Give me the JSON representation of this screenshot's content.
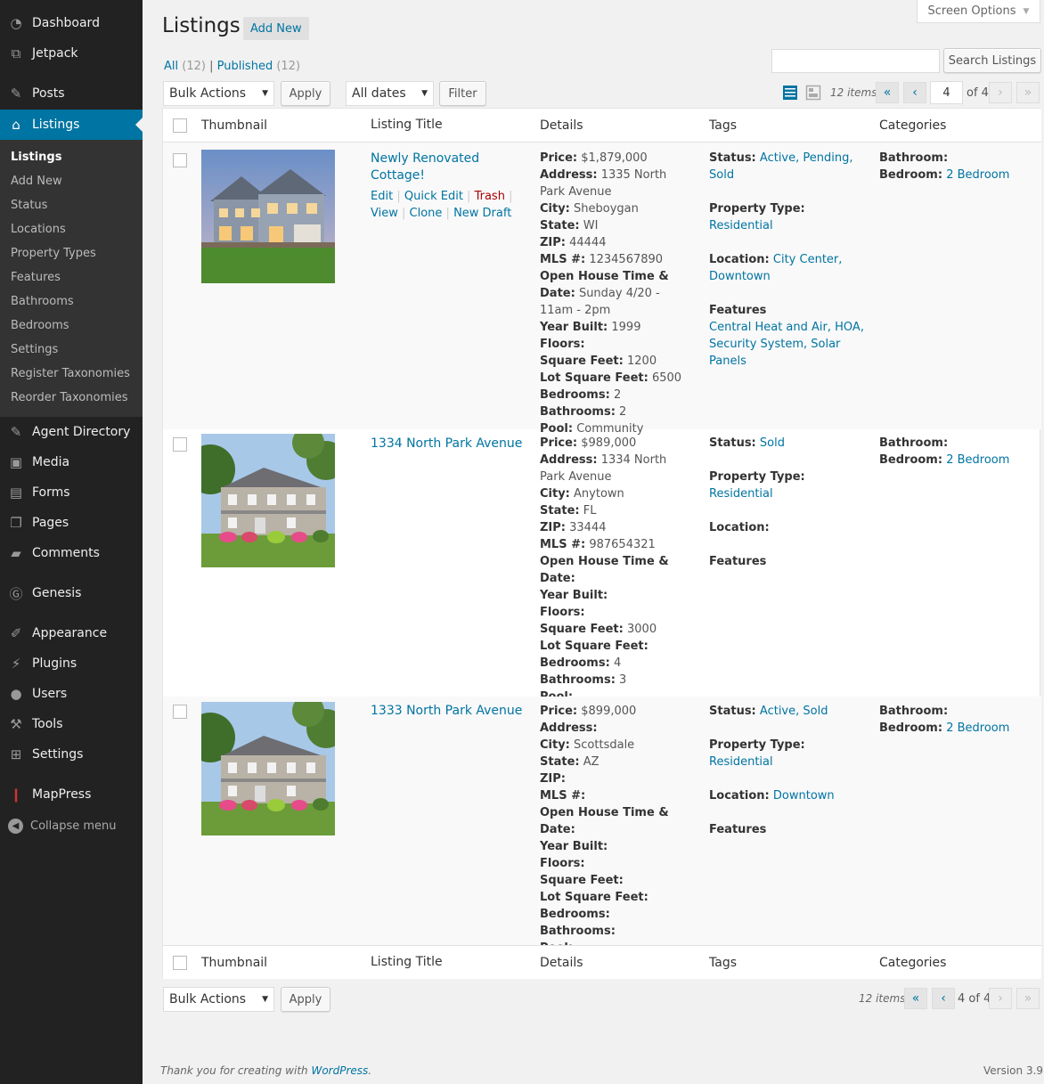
{
  "sidebar": {
    "menu": [
      {
        "label": "Dashboard",
        "icon": "dashboard-icon"
      },
      {
        "label": "Jetpack",
        "icon": "jetpack-icon"
      },
      {
        "label": "Posts",
        "icon": "pin-icon"
      },
      {
        "label": "Listings",
        "icon": "home-icon"
      },
      {
        "label": "Agent Directory",
        "icon": "pin-icon"
      },
      {
        "label": "Media",
        "icon": "media-icon"
      },
      {
        "label": "Forms",
        "icon": "forms-icon"
      },
      {
        "label": "Pages",
        "icon": "pages-icon"
      },
      {
        "label": "Comments",
        "icon": "comment-icon"
      },
      {
        "label": "Genesis",
        "icon": "genesis-icon"
      },
      {
        "label": "Appearance",
        "icon": "brush-icon"
      },
      {
        "label": "Plugins",
        "icon": "plug-icon"
      },
      {
        "label": "Users",
        "icon": "user-icon"
      },
      {
        "label": "Tools",
        "icon": "wrench-icon"
      },
      {
        "label": "Settings",
        "icon": "settings-icon"
      },
      {
        "label": "MapPress",
        "icon": "map-pin-icon"
      }
    ],
    "submenu": [
      "Listings",
      "Add New",
      "Status",
      "Locations",
      "Property Types",
      "Features",
      "Bathrooms",
      "Bedrooms",
      "Settings",
      "Register Taxonomies",
      "Reorder Taxonomies"
    ],
    "collapse_label": "Collapse menu"
  },
  "header": {
    "screen_options": "Screen Options",
    "title": "Listings",
    "add_new": "Add New",
    "filter_all": "All",
    "filter_all_count": "(12)",
    "filter_published": "Published",
    "filter_published_count": "(12)",
    "search_button": "Search Listings"
  },
  "toolbar": {
    "bulk_actions": "Bulk Actions",
    "apply": "Apply",
    "dates": "All dates",
    "filter": "Filter",
    "items": "12 items",
    "first": "«",
    "prev": "‹",
    "next": "›",
    "last": "»",
    "current_page": "4",
    "of_pages": "of 4",
    "bottom_page": "4 of 4"
  },
  "columns": {
    "thumbnail": "Thumbnail",
    "title": "Listing Title",
    "details": "Details",
    "tags": "Tags",
    "categories": "Categories"
  },
  "rows": [
    {
      "title": "Newly Renovated Cottage!",
      "actions": {
        "edit": "Edit",
        "quick_edit": "Quick Edit",
        "trash": "Trash",
        "view": "View",
        "clone": "Clone",
        "new_draft": "New Draft"
      },
      "details": [
        [
          "Price:",
          "$1,879,000"
        ],
        [
          "Address:",
          "1335 North Park Avenue"
        ],
        [
          "City:",
          "Sheboygan"
        ],
        [
          "State:",
          "WI"
        ],
        [
          "ZIP:",
          "44444"
        ],
        [
          "MLS #:",
          "1234567890"
        ],
        [
          "Open House Time & Date:",
          "Sunday 4/20 - 11am - 2pm"
        ],
        [
          "Year Built:",
          "1999"
        ],
        [
          "Floors:",
          ""
        ],
        [
          "Square Feet:",
          "1200"
        ],
        [
          "Lot Square Feet:",
          "6500"
        ],
        [
          "Bedrooms:",
          "2"
        ],
        [
          "Bathrooms:",
          "2"
        ],
        [
          "Pool:",
          "Community"
        ]
      ],
      "tags": {
        "status_label": "Status:",
        "status": "Active, Pending, Sold",
        "type_label": "Property Type:",
        "type": "Residential",
        "location_label": "Location:",
        "location": "City Center, Downtown",
        "features_label": "Features",
        "features": "Central Heat and Air, HOA, Security System, Solar Panels"
      },
      "cats": {
        "bath_label": "Bathroom:",
        "bath": "",
        "bed_label": "Bedroom:",
        "bed": "2 Bedroom"
      }
    },
    {
      "title": "1334 North Park Avenue",
      "details": [
        [
          "Price:",
          "$989,000"
        ],
        [
          "Address:",
          "1334 North Park Avenue"
        ],
        [
          "City:",
          "Anytown"
        ],
        [
          "State:",
          "FL"
        ],
        [
          "ZIP:",
          "33444"
        ],
        [
          "MLS #:",
          "987654321"
        ],
        [
          "Open House Time & Date:",
          ""
        ],
        [
          "Year Built:",
          ""
        ],
        [
          "Floors:",
          ""
        ],
        [
          "Square Feet:",
          "3000"
        ],
        [
          "Lot Square Feet:",
          ""
        ],
        [
          "Bedrooms:",
          "4"
        ],
        [
          "Bathrooms:",
          "3"
        ],
        [
          "Pool:",
          ""
        ]
      ],
      "tags": {
        "status_label": "Status:",
        "status": "Sold",
        "type_label": "Property Type:",
        "type": "Residential",
        "location_label": "Location:",
        "location": "",
        "features_label": "Features",
        "features": ""
      },
      "cats": {
        "bath_label": "Bathroom:",
        "bath": "",
        "bed_label": "Bedroom:",
        "bed": "2 Bedroom"
      }
    },
    {
      "title": "1333 North Park Avenue",
      "details": [
        [
          "Price:",
          "$899,000"
        ],
        [
          "Address:",
          ""
        ],
        [
          "City:",
          "Scottsdale"
        ],
        [
          "State:",
          "AZ"
        ],
        [
          "ZIP:",
          ""
        ],
        [
          "MLS #:",
          ""
        ],
        [
          "Open House Time & Date:",
          ""
        ],
        [
          "Year Built:",
          ""
        ],
        [
          "Floors:",
          ""
        ],
        [
          "Square Feet:",
          ""
        ],
        [
          "Lot Square Feet:",
          ""
        ],
        [
          "Bedrooms:",
          ""
        ],
        [
          "Bathrooms:",
          ""
        ],
        [
          "Pool:",
          ""
        ]
      ],
      "tags": {
        "status_label": "Status:",
        "status": "Active, Sold",
        "type_label": "Property Type:",
        "type": "Residential",
        "location_label": "Location:",
        "location": "Downtown",
        "features_label": "Features",
        "features": ""
      },
      "cats": {
        "bath_label": "Bathroom:",
        "bath": "",
        "bed_label": "Bedroom:",
        "bed": "2 Bedroom"
      }
    }
  ],
  "footer": {
    "thanks": "Thank you for creating with ",
    "wp": "WordPress",
    "period": ".",
    "version": "Version 3.9"
  }
}
